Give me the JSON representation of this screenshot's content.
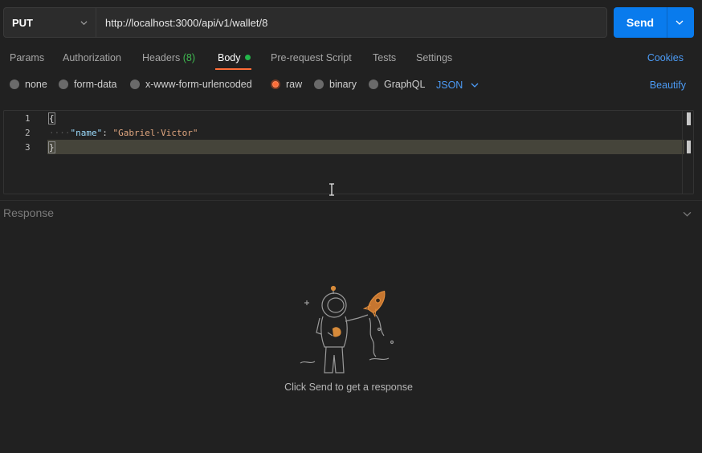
{
  "request": {
    "method": "PUT",
    "url": "http://localhost:3000/api/v1/wallet/8",
    "send_label": "Send"
  },
  "tabs": {
    "params": "Params",
    "authorization": "Authorization",
    "headers": "Headers",
    "headers_count": "(8)",
    "body": "Body",
    "prerequest": "Pre-request Script",
    "tests": "Tests",
    "settings": "Settings",
    "cookies": "Cookies"
  },
  "body_types": {
    "none": "none",
    "form_data": "form-data",
    "urlencoded": "x-www-form-urlencoded",
    "raw": "raw",
    "binary": "binary",
    "graphql": "GraphQL",
    "format": "JSON",
    "beautify": "Beautify",
    "selected": "raw"
  },
  "editor": {
    "line_numbers": [
      "1",
      "2",
      "3"
    ],
    "line1": "{",
    "line2_indent": "····",
    "line2_key": "\"name\"",
    "line2_colon": ": ",
    "line2_value": "\"Gabriel·Victor\"",
    "line3": "}"
  },
  "response": {
    "title": "Response",
    "empty_message": "Click Send to get a response"
  },
  "colors": {
    "accent": "#ff6c37",
    "send": "#097bed",
    "link": "#4c9bf5",
    "background": "#212121"
  }
}
